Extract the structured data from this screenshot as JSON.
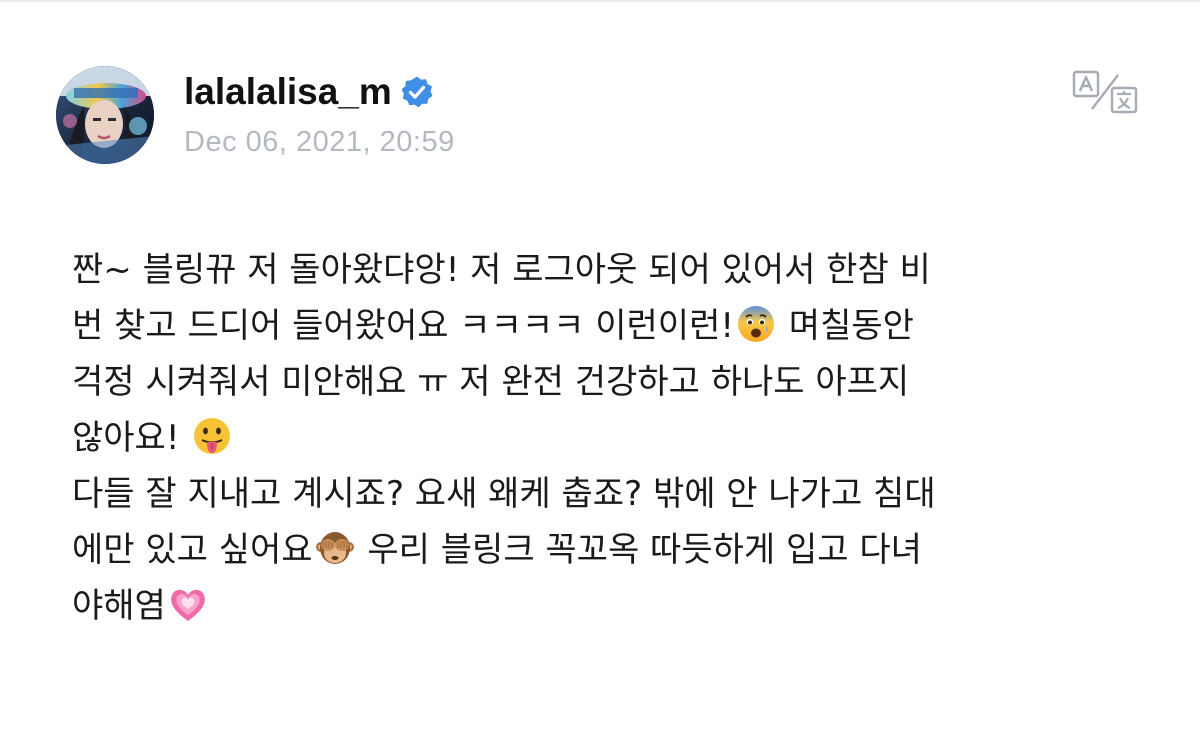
{
  "post": {
    "username": "lalalalisa_m",
    "verified": true,
    "timestamp": "Dec 06, 2021, 20:59",
    "avatar_icon": "avatar-photo",
    "translate_icon": "translate-icon",
    "lines": [
      {
        "text": "짠~ 블링뀨 저 돌아왔댜앙! 저 로그아웃 되어 있어서 한참 비"
      },
      {
        "text": "번 찾고 드디어 들어왔어요 ㅋㅋㅋㅋ 이런이런!",
        "emoji": "anxious-face-icon",
        "after": " 며칠동안"
      },
      {
        "text": "걱정 시켜줘서 미안해요 ㅠ 저 완전 건강하고 하나도 아프지"
      },
      {
        "text": "않아요! ",
        "emoji": "tongue-face-icon",
        "after": ""
      },
      {
        "text": "다들 잘 지내고 계시죠? 요새 왜케 춥죠? 밖에 안 나가고 침대"
      },
      {
        "text": "에만 있고 싶어요",
        "emoji": "see-no-evil-monkey-icon",
        "after": " 우리 블링크 꼭꼬옥 따듯하게 입고 다녀"
      },
      {
        "text": "야해염",
        "emoji": "growing-heart-icon",
        "after": ""
      }
    ]
  },
  "colors": {
    "username": "#111111",
    "timestamp": "#b4b8bf",
    "verified": "#3f8ee8",
    "body_text": "#1a1a1a",
    "icon_gray": "#a7abb2"
  }
}
